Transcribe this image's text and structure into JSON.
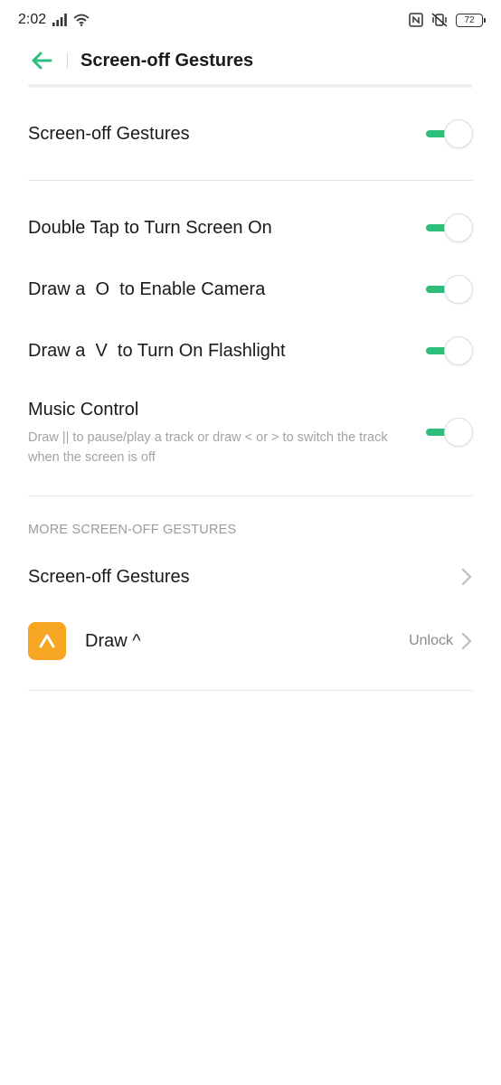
{
  "status_bar": {
    "time": "2:02",
    "battery": "72",
    "icons": [
      "signal-icon",
      "wifi-icon",
      "nfc-icon",
      "vibrate-off-icon",
      "battery-icon"
    ]
  },
  "header": {
    "title": "Screen-off Gestures",
    "back_icon": "back-arrow-icon"
  },
  "master": {
    "label": "Screen-off Gestures",
    "enabled": true
  },
  "gestures": [
    {
      "label": "Double Tap to Turn Screen On",
      "enabled": true
    },
    {
      "label": "Draw a  O  to Enable Camera",
      "enabled": true
    },
    {
      "label": "Draw a  V  to Turn On Flashlight",
      "enabled": true
    }
  ],
  "music": {
    "title": "Music Control",
    "description": "Draw || to pause/play a track or draw < or > to switch the track when the screen is off",
    "enabled": true
  },
  "more": {
    "section_title": "MORE SCREEN-OFF GESTURES",
    "link_label": "Screen-off Gestures",
    "draw_label": "Draw ^",
    "draw_status": "Unlock",
    "draw_icon_glyph": "^"
  },
  "colors": {
    "accent": "#2dbe7b",
    "app_icon": "#f6a623"
  }
}
